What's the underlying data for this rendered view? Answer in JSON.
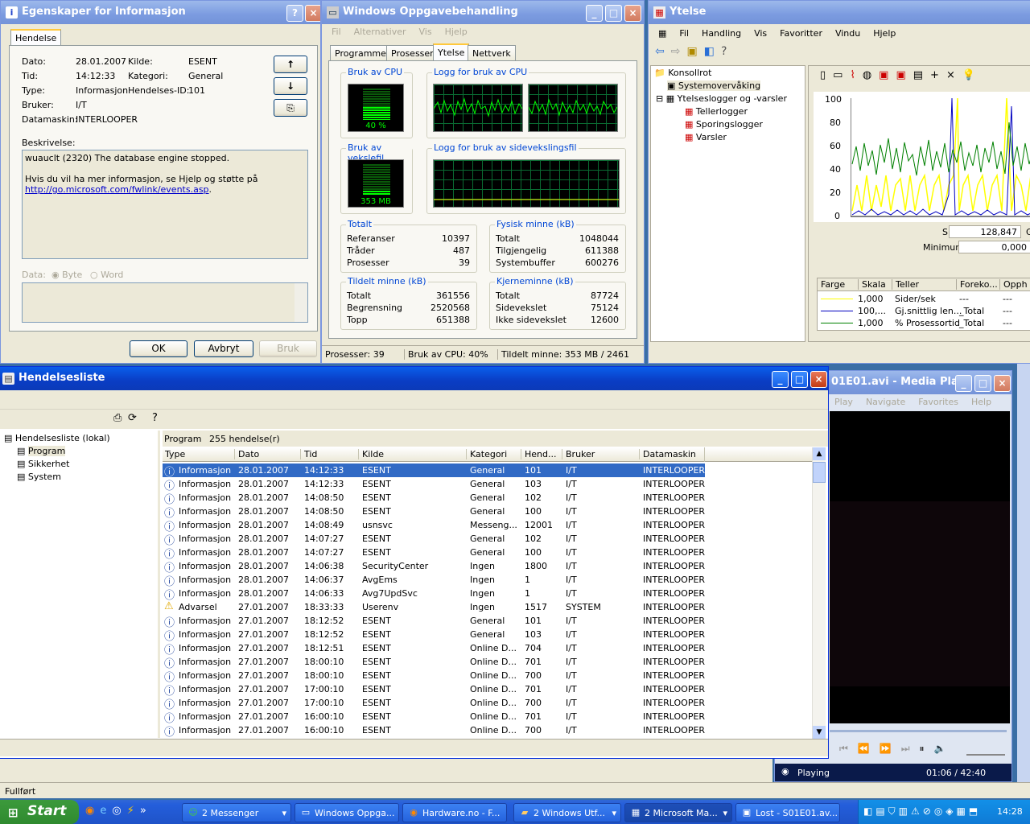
{
  "props": {
    "title": "Egenskaper for Informasjon",
    "help_btn": "?",
    "close_btn": "×",
    "tab": "Hendelse",
    "date_label": "Dato:",
    "date": "28.01.2007",
    "source_label": "Kilde:",
    "source": "ESENT",
    "time_label": "Tid:",
    "time": "14:12:33",
    "category_label": "Kategori:",
    "category": "General",
    "type_label": "Type:",
    "type": "Informasjon",
    "event_id_label": "Hendelses-ID:",
    "event_id": "101",
    "user_label": "Bruker:",
    "user": "I/T",
    "computer_label": "Datamaskin:",
    "computer": "INTERLOOPER",
    "desc_label": "Beskrivelse:",
    "desc_line1": "wuauclt (2320) The database engine stopped.",
    "desc_line2": "Hvis du vil ha mer informasjon, se Hjelp og støtte på",
    "desc_link": "http://go.microsoft.com/fwlink/events.asp",
    "desc_period": ".",
    "data_label": "Data:",
    "byte_label": "Byte",
    "word_label": "Word",
    "ok": "OK",
    "cancel": "Avbryt",
    "apply": "Bruk",
    "up": "↑",
    "down": "↓"
  },
  "taskmgr": {
    "title": "Windows Oppgavebehandling",
    "min": "_",
    "max": "□",
    "close": "×",
    "menu": [
      "Fil",
      "Alternativer",
      "Vis",
      "Hjelp"
    ],
    "tabs": [
      "Programmer",
      "Prosesser",
      "Ytelse",
      "Nettverk"
    ],
    "cpu_usage_label": "Bruk av CPU",
    "cpu_usage": "40 %",
    "cpu_usage_value": 0.4,
    "cpu_history_label": "Logg for bruk av CPU",
    "pf_usage_label": "Bruk av vekslefil",
    "pf_usage": "353 MB",
    "pf_history_label": "Logg for bruk av sidevekslingsfil",
    "totals": {
      "label": "Totalt",
      "rows": [
        [
          "Referanser",
          "10397"
        ],
        [
          "Tråder",
          "487"
        ],
        [
          "Prosesser",
          "39"
        ]
      ]
    },
    "physical": {
      "label": "Fysisk minne (kB)",
      "rows": [
        [
          "Totalt",
          "1048044"
        ],
        [
          "Tilgjengelig",
          "611388"
        ],
        [
          "Systembuffer",
          "600276"
        ]
      ]
    },
    "commit": {
      "label": "Tildelt minne (kB)",
      "rows": [
        [
          "Totalt",
          "361556"
        ],
        [
          "Begrensning",
          "2520568"
        ],
        [
          "Topp",
          "651388"
        ]
      ]
    },
    "kernel": {
      "label": "Kjerneminne (kB)",
      "rows": [
        [
          "Totalt",
          "87724"
        ],
        [
          "Sidevekslet",
          "75124"
        ],
        [
          "Ikke sidevekslet",
          "12600"
        ]
      ]
    },
    "status": [
      "Prosesser: 39",
      "Bruk av CPU: 40%",
      "Tildelt minne: 353 MB / 2461"
    ]
  },
  "perf": {
    "title": "Ytelse",
    "menu": [
      "Fil",
      "Handling",
      "Vis",
      "Favoritter",
      "Vindu",
      "Hjelp"
    ],
    "tree": [
      "Konsollrot",
      "Systemovervåking",
      "Ytelseslogger og -varsler",
      "Tellerlogger",
      "Sporingslogger",
      "Varsler"
    ],
    "yticks": [
      "100",
      "80",
      "60",
      "40",
      "20",
      "0"
    ],
    "last_label": "Siste",
    "last_value": "128,847",
    "avg_label": "Gj",
    "min_label": "Minimum",
    "min_value": "0,000",
    "columns": [
      "Farge",
      "Skala",
      "Teller",
      "Foreko...",
      "Opph"
    ],
    "counters": [
      {
        "color": "#ffff00",
        "scale": "1,000",
        "counter": "Sider/sek",
        "instance": "---",
        "parent": "---"
      },
      {
        "color": "#0000c0",
        "scale": "100,...",
        "counter": "Gj.snittlig len...",
        "instance": "_Total",
        "parent": "---"
      },
      {
        "color": "#008000",
        "scale": "1,000",
        "counter": "% Prosessortid",
        "instance": "_Total",
        "parent": "---"
      }
    ]
  },
  "eventlist": {
    "title": "Hendelsesliste",
    "min": "_",
    "max": "□",
    "close": "×",
    "tree": [
      "Hendelsesliste (lokal)",
      "Program",
      "Sikkerhet",
      "System"
    ],
    "header_name": "Program",
    "header_count": "255 hendelse(r)",
    "columns": [
      "Type",
      "Dato",
      "Tid",
      "Kilde",
      "Kategori",
      "Hend...",
      "Bruker",
      "Datamaskin"
    ],
    "rows": [
      [
        "Informasjon",
        "28.01.2007",
        "14:12:33",
        "ESENT",
        "General",
        "101",
        "I/T",
        "INTERLOOPER"
      ],
      [
        "Informasjon",
        "28.01.2007",
        "14:12:33",
        "ESENT",
        "General",
        "103",
        "I/T",
        "INTERLOOPER"
      ],
      [
        "Informasjon",
        "28.01.2007",
        "14:08:50",
        "ESENT",
        "General",
        "102",
        "I/T",
        "INTERLOOPER"
      ],
      [
        "Informasjon",
        "28.01.2007",
        "14:08:50",
        "ESENT",
        "General",
        "100",
        "I/T",
        "INTERLOOPER"
      ],
      [
        "Informasjon",
        "28.01.2007",
        "14:08:49",
        "usnsvc",
        "Messeng...",
        "12001",
        "I/T",
        "INTERLOOPER"
      ],
      [
        "Informasjon",
        "28.01.2007",
        "14:07:27",
        "ESENT",
        "General",
        "102",
        "I/T",
        "INTERLOOPER"
      ],
      [
        "Informasjon",
        "28.01.2007",
        "14:07:27",
        "ESENT",
        "General",
        "100",
        "I/T",
        "INTERLOOPER"
      ],
      [
        "Informasjon",
        "28.01.2007",
        "14:06:38",
        "SecurityCenter",
        "Ingen",
        "1800",
        "I/T",
        "INTERLOOPER"
      ],
      [
        "Informasjon",
        "28.01.2007",
        "14:06:37",
        "AvgEms",
        "Ingen",
        "1",
        "I/T",
        "INTERLOOPER"
      ],
      [
        "Informasjon",
        "28.01.2007",
        "14:06:33",
        "Avg7UpdSvc",
        "Ingen",
        "1",
        "I/T",
        "INTERLOOPER"
      ],
      [
        "Advarsel",
        "27.01.2007",
        "18:33:33",
        "Userenv",
        "Ingen",
        "1517",
        "SYSTEM",
        "INTERLOOPER"
      ],
      [
        "Informasjon",
        "27.01.2007",
        "18:12:52",
        "ESENT",
        "General",
        "101",
        "I/T",
        "INTERLOOPER"
      ],
      [
        "Informasjon",
        "27.01.2007",
        "18:12:52",
        "ESENT",
        "General",
        "103",
        "I/T",
        "INTERLOOPER"
      ],
      [
        "Informasjon",
        "27.01.2007",
        "18:12:51",
        "ESENT",
        "Online D...",
        "704",
        "I/T",
        "INTERLOOPER"
      ],
      [
        "Informasjon",
        "27.01.2007",
        "18:00:10",
        "ESENT",
        "Online D...",
        "701",
        "I/T",
        "INTERLOOPER"
      ],
      [
        "Informasjon",
        "27.01.2007",
        "18:00:10",
        "ESENT",
        "Online D...",
        "700",
        "I/T",
        "INTERLOOPER"
      ],
      [
        "Informasjon",
        "27.01.2007",
        "17:00:10",
        "ESENT",
        "Online D...",
        "701",
        "I/T",
        "INTERLOOPER"
      ],
      [
        "Informasjon",
        "27.01.2007",
        "17:00:10",
        "ESENT",
        "Online D...",
        "700",
        "I/T",
        "INTERLOOPER"
      ],
      [
        "Informasjon",
        "27.01.2007",
        "16:00:10",
        "ESENT",
        "Online D...",
        "701",
        "I/T",
        "INTERLOOPER"
      ],
      [
        "Informasjon",
        "27.01.2007",
        "16:00:10",
        "ESENT",
        "Online D...",
        "700",
        "I/T",
        "INTERLOOPER"
      ]
    ]
  },
  "media": {
    "title": "01E01.avi - Media Pla...",
    "menu": [
      "Play",
      "Navigate",
      "Favorites",
      "Help"
    ],
    "status": "Playing",
    "time": "01:06 / 42:40"
  },
  "statusbar": "Fullført",
  "taskbar": {
    "start": "Start",
    "buttons": [
      "2 Messenger",
      "Windows Oppga...",
      "Hardware.no - F...",
      "2 Windows Utf...",
      "2 Microsoft Ma...",
      "Lost - S01E01.av..."
    ],
    "clock": "14:28"
  }
}
